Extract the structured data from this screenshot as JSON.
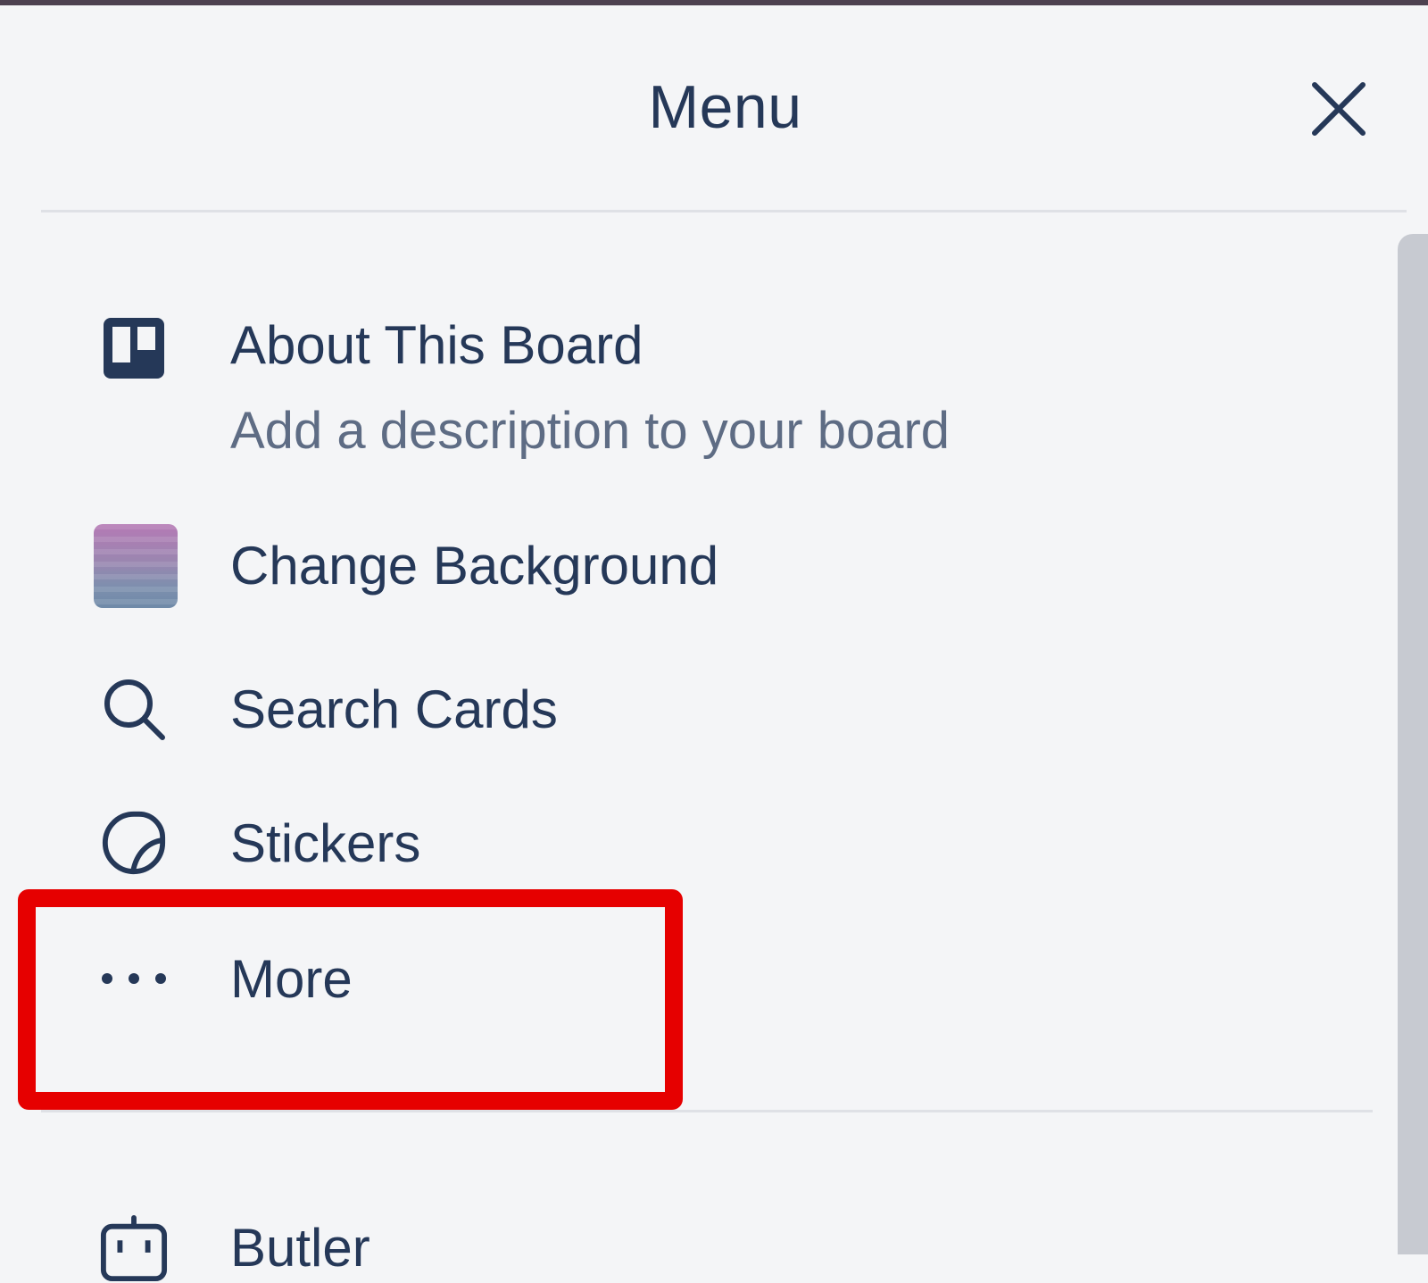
{
  "header": {
    "title": "Menu",
    "close_icon": "close-icon"
  },
  "menu": {
    "items": [
      {
        "label": "About This Board",
        "subtitle": "Add a description to your board",
        "icon": "board-icon"
      },
      {
        "label": "Change Background",
        "icon": "background-swatch-icon"
      },
      {
        "label": "Search Cards",
        "icon": "search-icon"
      },
      {
        "label": "Stickers",
        "icon": "sticker-icon"
      },
      {
        "label": "More",
        "icon": "ellipsis-icon",
        "highlighted": true
      },
      {
        "label": "Butler",
        "icon": "robot-icon"
      }
    ]
  },
  "colors": {
    "background": "#f4f5f7",
    "text": "#253858",
    "subtext": "#5e6c84",
    "highlight": "#e60000",
    "swatch_top": "#b57ab5",
    "swatch_bottom": "#6f8aa8"
  }
}
